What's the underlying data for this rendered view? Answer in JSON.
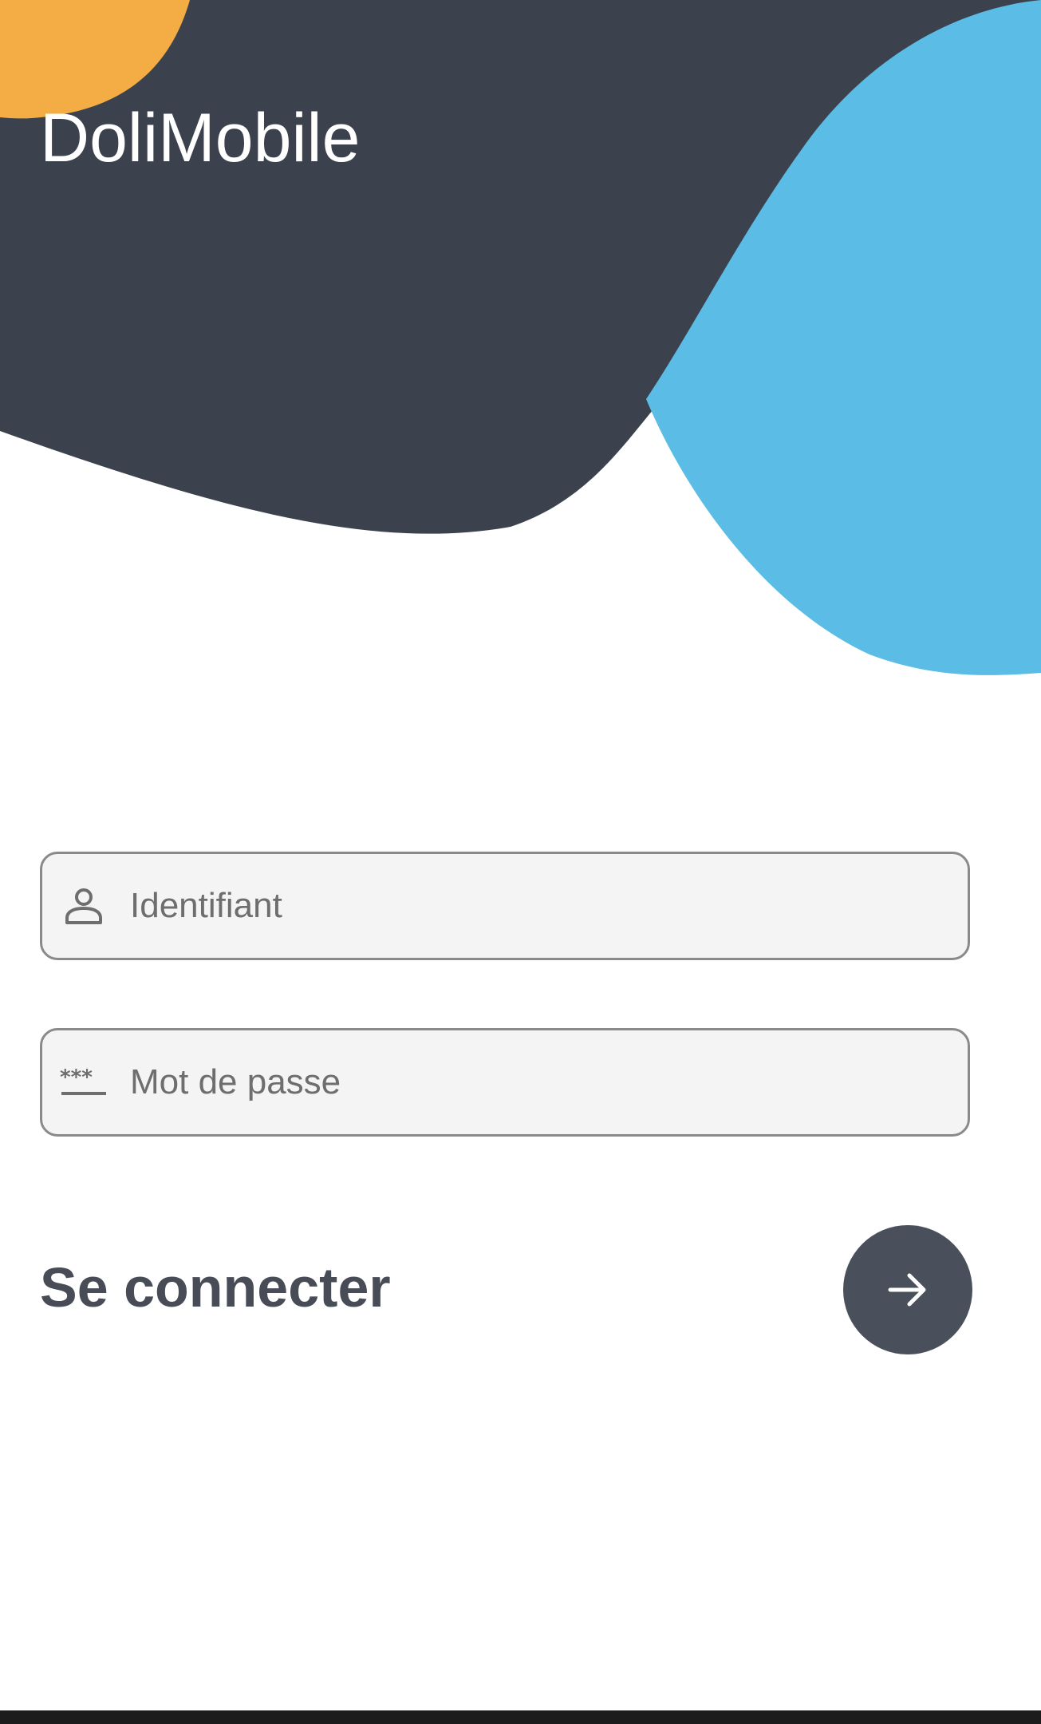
{
  "app": {
    "title": "DoliMobile"
  },
  "login": {
    "username": {
      "placeholder": "Identifiant",
      "value": "",
      "icon": "person-outline-icon"
    },
    "password": {
      "placeholder": "Mot de passe",
      "value": "",
      "icon": "password-asterisks-icon"
    },
    "submit_label": "Se connecter",
    "submit_icon": "arrow-right-icon"
  },
  "colors": {
    "header_dark": "#3b424d",
    "accent_blue": "#5bbde6",
    "accent_orange": "#f4ad45",
    "button_dark": "#4a505b",
    "label_text": "#474c56"
  }
}
